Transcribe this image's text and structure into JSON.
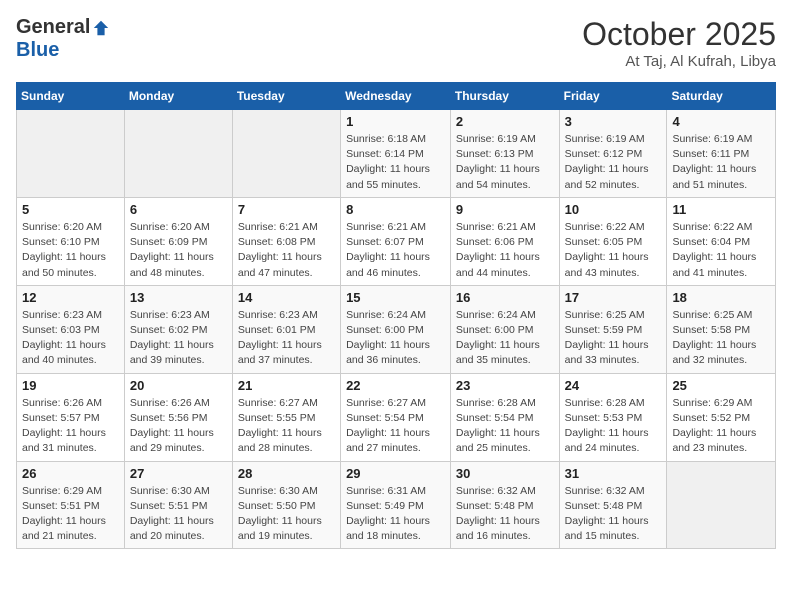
{
  "header": {
    "logo_general": "General",
    "logo_blue": "Blue",
    "month_title": "October 2025",
    "location": "At Taj, Al Kufrah, Libya"
  },
  "weekdays": [
    "Sunday",
    "Monday",
    "Tuesday",
    "Wednesday",
    "Thursday",
    "Friday",
    "Saturday"
  ],
  "weeks": [
    [
      {
        "day": "",
        "detail": ""
      },
      {
        "day": "",
        "detail": ""
      },
      {
        "day": "",
        "detail": ""
      },
      {
        "day": "1",
        "detail": "Sunrise: 6:18 AM\nSunset: 6:14 PM\nDaylight: 11 hours\nand 55 minutes."
      },
      {
        "day": "2",
        "detail": "Sunrise: 6:19 AM\nSunset: 6:13 PM\nDaylight: 11 hours\nand 54 minutes."
      },
      {
        "day": "3",
        "detail": "Sunrise: 6:19 AM\nSunset: 6:12 PM\nDaylight: 11 hours\nand 52 minutes."
      },
      {
        "day": "4",
        "detail": "Sunrise: 6:19 AM\nSunset: 6:11 PM\nDaylight: 11 hours\nand 51 minutes."
      }
    ],
    [
      {
        "day": "5",
        "detail": "Sunrise: 6:20 AM\nSunset: 6:10 PM\nDaylight: 11 hours\nand 50 minutes."
      },
      {
        "day": "6",
        "detail": "Sunrise: 6:20 AM\nSunset: 6:09 PM\nDaylight: 11 hours\nand 48 minutes."
      },
      {
        "day": "7",
        "detail": "Sunrise: 6:21 AM\nSunset: 6:08 PM\nDaylight: 11 hours\nand 47 minutes."
      },
      {
        "day": "8",
        "detail": "Sunrise: 6:21 AM\nSunset: 6:07 PM\nDaylight: 11 hours\nand 46 minutes."
      },
      {
        "day": "9",
        "detail": "Sunrise: 6:21 AM\nSunset: 6:06 PM\nDaylight: 11 hours\nand 44 minutes."
      },
      {
        "day": "10",
        "detail": "Sunrise: 6:22 AM\nSunset: 6:05 PM\nDaylight: 11 hours\nand 43 minutes."
      },
      {
        "day": "11",
        "detail": "Sunrise: 6:22 AM\nSunset: 6:04 PM\nDaylight: 11 hours\nand 41 minutes."
      }
    ],
    [
      {
        "day": "12",
        "detail": "Sunrise: 6:23 AM\nSunset: 6:03 PM\nDaylight: 11 hours\nand 40 minutes."
      },
      {
        "day": "13",
        "detail": "Sunrise: 6:23 AM\nSunset: 6:02 PM\nDaylight: 11 hours\nand 39 minutes."
      },
      {
        "day": "14",
        "detail": "Sunrise: 6:23 AM\nSunset: 6:01 PM\nDaylight: 11 hours\nand 37 minutes."
      },
      {
        "day": "15",
        "detail": "Sunrise: 6:24 AM\nSunset: 6:00 PM\nDaylight: 11 hours\nand 36 minutes."
      },
      {
        "day": "16",
        "detail": "Sunrise: 6:24 AM\nSunset: 6:00 PM\nDaylight: 11 hours\nand 35 minutes."
      },
      {
        "day": "17",
        "detail": "Sunrise: 6:25 AM\nSunset: 5:59 PM\nDaylight: 11 hours\nand 33 minutes."
      },
      {
        "day": "18",
        "detail": "Sunrise: 6:25 AM\nSunset: 5:58 PM\nDaylight: 11 hours\nand 32 minutes."
      }
    ],
    [
      {
        "day": "19",
        "detail": "Sunrise: 6:26 AM\nSunset: 5:57 PM\nDaylight: 11 hours\nand 31 minutes."
      },
      {
        "day": "20",
        "detail": "Sunrise: 6:26 AM\nSunset: 5:56 PM\nDaylight: 11 hours\nand 29 minutes."
      },
      {
        "day": "21",
        "detail": "Sunrise: 6:27 AM\nSunset: 5:55 PM\nDaylight: 11 hours\nand 28 minutes."
      },
      {
        "day": "22",
        "detail": "Sunrise: 6:27 AM\nSunset: 5:54 PM\nDaylight: 11 hours\nand 27 minutes."
      },
      {
        "day": "23",
        "detail": "Sunrise: 6:28 AM\nSunset: 5:54 PM\nDaylight: 11 hours\nand 25 minutes."
      },
      {
        "day": "24",
        "detail": "Sunrise: 6:28 AM\nSunset: 5:53 PM\nDaylight: 11 hours\nand 24 minutes."
      },
      {
        "day": "25",
        "detail": "Sunrise: 6:29 AM\nSunset: 5:52 PM\nDaylight: 11 hours\nand 23 minutes."
      }
    ],
    [
      {
        "day": "26",
        "detail": "Sunrise: 6:29 AM\nSunset: 5:51 PM\nDaylight: 11 hours\nand 21 minutes."
      },
      {
        "day": "27",
        "detail": "Sunrise: 6:30 AM\nSunset: 5:51 PM\nDaylight: 11 hours\nand 20 minutes."
      },
      {
        "day": "28",
        "detail": "Sunrise: 6:30 AM\nSunset: 5:50 PM\nDaylight: 11 hours\nand 19 minutes."
      },
      {
        "day": "29",
        "detail": "Sunrise: 6:31 AM\nSunset: 5:49 PM\nDaylight: 11 hours\nand 18 minutes."
      },
      {
        "day": "30",
        "detail": "Sunrise: 6:32 AM\nSunset: 5:48 PM\nDaylight: 11 hours\nand 16 minutes."
      },
      {
        "day": "31",
        "detail": "Sunrise: 6:32 AM\nSunset: 5:48 PM\nDaylight: 11 hours\nand 15 minutes."
      },
      {
        "day": "",
        "detail": ""
      }
    ]
  ]
}
